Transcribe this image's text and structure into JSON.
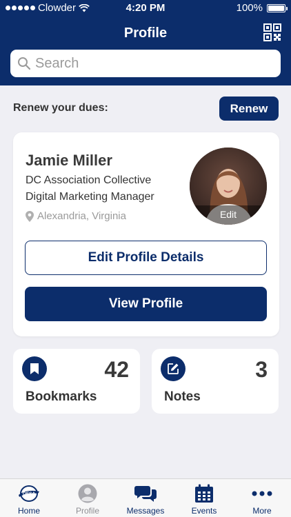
{
  "status_bar": {
    "carrier": "Clowder",
    "time": "4:20 PM",
    "battery": "100%"
  },
  "header": {
    "title": "Profile",
    "qr_icon": "qr-code-icon"
  },
  "search": {
    "placeholder": "Search"
  },
  "dues": {
    "label": "Renew your dues:",
    "button": "Renew"
  },
  "profile": {
    "name": "Jamie Miller",
    "organization": "DC Association Collective",
    "title": "Digital Marketing Manager",
    "location": "Alexandria, Virginia",
    "avatar_edit": "Edit",
    "edit_button": "Edit Profile Details",
    "view_button": "View Profile"
  },
  "stats": [
    {
      "label": "Bookmarks",
      "count": "42",
      "icon": "bookmark-icon"
    },
    {
      "label": "Notes",
      "count": "3",
      "icon": "edit-note-icon"
    }
  ],
  "tabs": [
    {
      "label": "Home",
      "icon": "oesa-logo-icon",
      "active": true
    },
    {
      "label": "Profile",
      "icon": "person-icon",
      "active": false
    },
    {
      "label": "Messages",
      "icon": "chat-bubbles-icon",
      "active": true
    },
    {
      "label": "Events",
      "icon": "calendar-icon",
      "active": true
    },
    {
      "label": "More",
      "icon": "more-dots-icon",
      "active": true
    }
  ],
  "colors": {
    "primary": "#0c2d6b",
    "background": "#efeff4",
    "inactive": "#8e8e93"
  }
}
